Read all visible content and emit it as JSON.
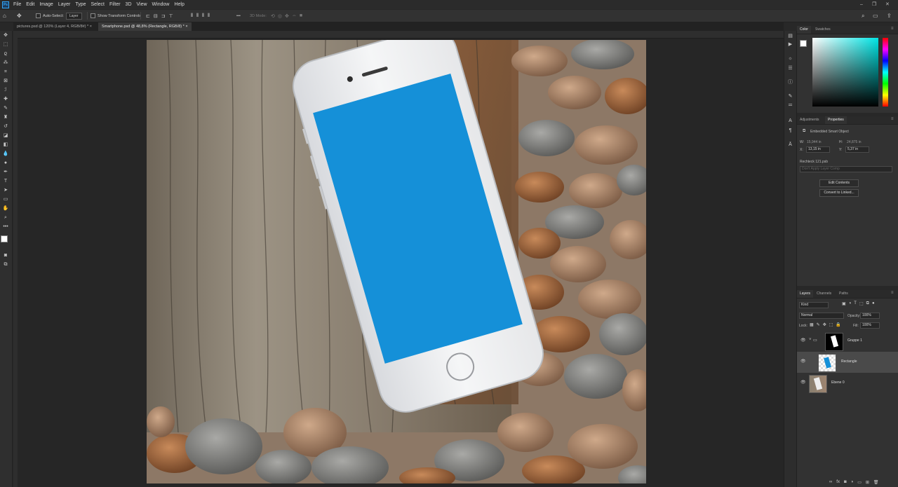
{
  "app": {
    "logo": "Ps"
  },
  "menu": [
    "File",
    "Edit",
    "Image",
    "Layer",
    "Type",
    "Select",
    "Filter",
    "3D",
    "View",
    "Window",
    "Help"
  ],
  "window_controls": {
    "minimize": "–",
    "restore": "❐",
    "close": "✕"
  },
  "options_bar": {
    "auto_select_label": "Auto-Select:",
    "layer_dropdown": "Layer",
    "show_transform_label": "Show Transform Controls",
    "three_d_mode_label": "3D Mode:",
    "more_label": "•••"
  },
  "tabs": [
    {
      "label": "pictures.psd @ 120% (Layer 4, RGB/8#) *",
      "close": "×"
    },
    {
      "label": "Smartphone.psd @ 48,8% (Rectangle, RGB/8) *",
      "close": "×"
    }
  ],
  "color_panel": {
    "tabs": [
      "Color",
      "Swatches"
    ],
    "foreground": "#ffffff",
    "background": "#000000",
    "hue_color": "#00e5e5"
  },
  "properties_panel": {
    "tabs": [
      "Adjustments",
      "Properties"
    ],
    "type_label": "Embedded Smart Object",
    "w_label": "W:",
    "w_value": "15,944 in",
    "h_label": "H:",
    "h_value": "24,875 in",
    "x_label": "X:",
    "x_value": "13,15 in",
    "y_label": "Y:",
    "y_value": "5,37 in",
    "file_name": "Rechteck 121.psb",
    "layer_comp_dropdown": "Don't Apply Layer Comp",
    "edit_contents": "Edit Contents",
    "convert_linked": "Convert to Linked..."
  },
  "layers_panel": {
    "tabs": [
      "Layers",
      "Channels",
      "Paths"
    ],
    "kind_label": "Kind",
    "blend_mode": "Normal",
    "opacity_label": "Opacity:",
    "opacity_value": "100%",
    "lock_label": "Lock:",
    "fill_label": "Fill:",
    "fill_value": "100%",
    "layers": [
      {
        "name": "Gruppe 1",
        "type": "group"
      },
      {
        "name": "Rectangle",
        "type": "smart-object",
        "selected": true
      },
      {
        "name": "Ebene 0",
        "type": "pixel"
      }
    ]
  },
  "colors": {
    "screen_blue": "#1590d8",
    "accent": "#31a8ff"
  }
}
